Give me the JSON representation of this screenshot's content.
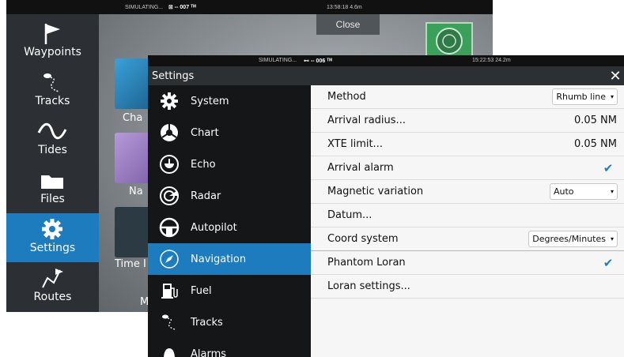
{
  "background_window": {
    "status": {
      "simulating": "SIMULATING...",
      "signal": "⊠ -- 007 ᵀᴹ",
      "time": "13:58:18  4.6m"
    },
    "sidebar": [
      {
        "label": "Waypoints",
        "icon": "flag-icon"
      },
      {
        "label": "Tracks",
        "icon": "tracks-icon"
      },
      {
        "label": "Tides",
        "icon": "tides-icon"
      },
      {
        "label": "Files",
        "icon": "folder-icon"
      },
      {
        "label": "Settings",
        "icon": "gear-icon",
        "active": true
      },
      {
        "label": "Routes",
        "icon": "routes-icon"
      }
    ],
    "tiles": [
      "Cha",
      "Na",
      "Time I",
      "MC"
    ],
    "close_label": "Close"
  },
  "settings_window": {
    "status": {
      "simulating": "SIMULATING...",
      "signal": "⊷ -- 006 ᵀᴹ",
      "time": "15:22:53  24.2m"
    },
    "title": "Settings",
    "close_glyph": "✕",
    "nav": [
      {
        "label": "System",
        "icon": "gear-icon"
      },
      {
        "label": "Chart",
        "icon": "chart-icon"
      },
      {
        "label": "Echo",
        "icon": "echo-icon"
      },
      {
        "label": "Radar",
        "icon": "radar-icon"
      },
      {
        "label": "Autopilot",
        "icon": "autopilot-icon"
      },
      {
        "label": "Navigation",
        "icon": "compass-icon",
        "active": true
      },
      {
        "label": "Fuel",
        "icon": "fuel-icon"
      },
      {
        "label": "Tracks",
        "icon": "tracks-icon"
      },
      {
        "label": "Alarms",
        "icon": "bell-icon"
      }
    ],
    "rows": [
      {
        "label": "Method",
        "type": "dropdown",
        "value": "Rhumb line"
      },
      {
        "label": "Arrival radius...",
        "type": "value",
        "value": "0.05 NM"
      },
      {
        "label": "XTE limit...",
        "type": "value",
        "value": "0.05 NM"
      },
      {
        "label": "Arrival alarm",
        "type": "checkbox",
        "checked": true
      },
      {
        "label": "Magnetic variation",
        "type": "dropdown",
        "value": "Auto"
      },
      {
        "label": "Datum...",
        "type": "none"
      },
      {
        "label": "Coord system",
        "type": "dropdown",
        "value": "Degrees/Minutes"
      },
      {
        "label": "Phantom Loran",
        "type": "checkbox",
        "checked": true
      },
      {
        "label": "Loran settings...",
        "type": "none"
      }
    ],
    "accent": "#1c7cbd"
  }
}
